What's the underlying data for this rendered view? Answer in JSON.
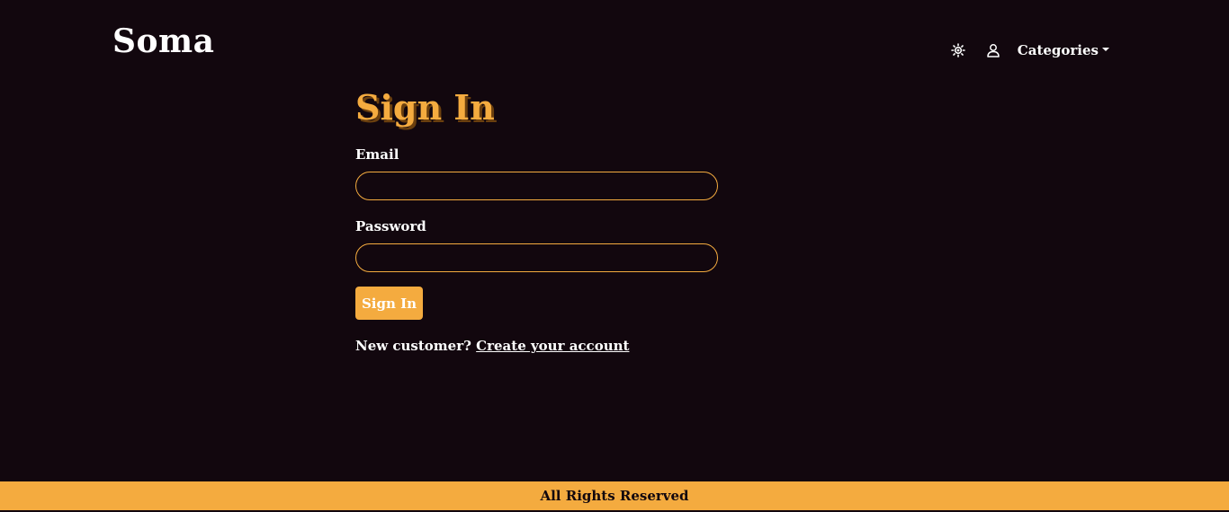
{
  "header": {
    "brand": "Soma",
    "nav": {
      "theme_icon": "sun-icon",
      "user_icon": "user-icon",
      "categories_label": "Categories"
    }
  },
  "form": {
    "title": "Sign In",
    "email_label": "Email",
    "email_value": "",
    "password_label": "Password",
    "password_value": "",
    "submit_label": "Sign In",
    "signup_prompt": "New customer?",
    "signup_link": "Create your account"
  },
  "footer": {
    "text": "All Rights Reserved"
  },
  "colors": {
    "background": "#12070e",
    "accent": "#f4ab3f",
    "text": "#ffffff"
  }
}
